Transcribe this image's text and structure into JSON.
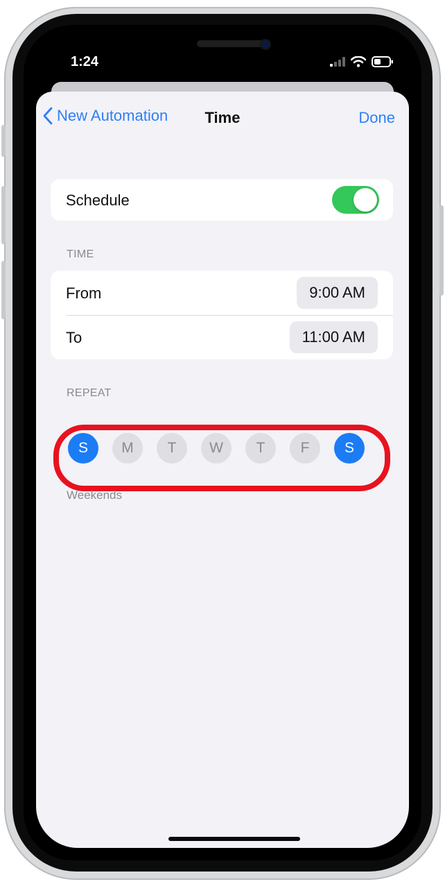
{
  "status_bar": {
    "time": "1:24"
  },
  "nav": {
    "back_label": "New Automation",
    "title": "Time",
    "done_label": "Done"
  },
  "schedule": {
    "label": "Schedule",
    "enabled": true
  },
  "time_section": {
    "header": "TIME",
    "from_label": "From",
    "from_value": "9:00 AM",
    "to_label": "To",
    "to_value": "11:00 AM"
  },
  "repeat_section": {
    "header": "REPEAT",
    "days": [
      {
        "letter": "S",
        "selected": true
      },
      {
        "letter": "M",
        "selected": false
      },
      {
        "letter": "T",
        "selected": false
      },
      {
        "letter": "W",
        "selected": false
      },
      {
        "letter": "T",
        "selected": false
      },
      {
        "letter": "F",
        "selected": false
      },
      {
        "letter": "S",
        "selected": true
      }
    ],
    "summary": "Weekends"
  },
  "colors": {
    "accent": "#2f7ff5",
    "toggle_on": "#34c759",
    "highlight": "#e8121f"
  }
}
